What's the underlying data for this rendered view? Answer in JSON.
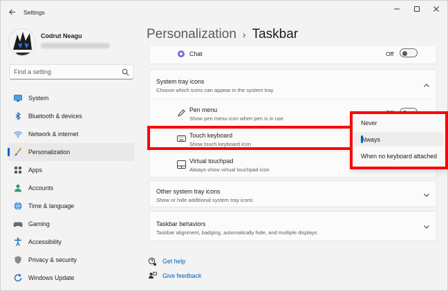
{
  "window": {
    "title": "Settings"
  },
  "account": {
    "name": "Codrut Neagu"
  },
  "search": {
    "placeholder": "Find a setting"
  },
  "sidebar": {
    "items": [
      {
        "label": "System",
        "icon": "system-icon"
      },
      {
        "label": "Bluetooth & devices",
        "icon": "bluetooth-icon"
      },
      {
        "label": "Network & internet",
        "icon": "wifi-icon"
      },
      {
        "label": "Personalization",
        "icon": "brush-icon",
        "selected": true
      },
      {
        "label": "Apps",
        "icon": "apps-icon"
      },
      {
        "label": "Accounts",
        "icon": "person-icon"
      },
      {
        "label": "Time & language",
        "icon": "globe-clock-icon"
      },
      {
        "label": "Gaming",
        "icon": "gamepad-icon"
      },
      {
        "label": "Accessibility",
        "icon": "accessibility-icon"
      },
      {
        "label": "Privacy & security",
        "icon": "shield-icon"
      },
      {
        "label": "Windows Update",
        "icon": "update-icon"
      }
    ]
  },
  "header": {
    "parent": "Personalization",
    "separator": "›",
    "current": "Taskbar"
  },
  "chat": {
    "title": "Chat",
    "state": "Off"
  },
  "system_tray": {
    "title": "System tray icons",
    "description": "Choose which icons can appear in the system tray",
    "items": [
      {
        "title": "Pen menu",
        "description": "Show pen menu icon when pen is in use",
        "state": "Off"
      },
      {
        "title": "Touch keyboard",
        "description": "Show touch keyboard icon"
      },
      {
        "title": "Virtual touchpad",
        "description": "Always show virtual touchpad icon"
      }
    ]
  },
  "other_tray": {
    "title": "Other system tray icons",
    "description": "Show or hide additional system tray icons"
  },
  "behaviors": {
    "title": "Taskbar behaviors",
    "description": "Taskbar alignment, badging, automatically hide, and multiple displays"
  },
  "links": {
    "help": "Get help",
    "feedback": "Give feedback"
  },
  "dropdown": {
    "options": [
      "Never",
      "Always",
      "When no keyboard attached"
    ],
    "selected": "Always"
  },
  "colors": {
    "accent": "#005fb8",
    "highlight": "#ff0000",
    "background": "#f3f3f3",
    "card": "#fbfbfb"
  }
}
